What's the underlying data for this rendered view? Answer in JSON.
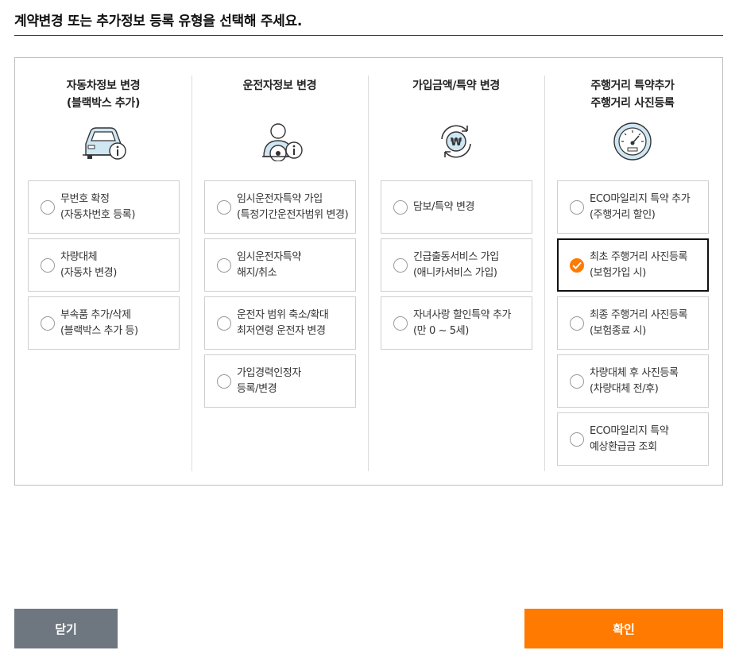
{
  "header": {
    "title": "계약변경 또는 추가정보 등록 유형을 선택해 주세요."
  },
  "columns": [
    {
      "title": [
        "자동차정보 변경",
        "(블랙박스 추가)"
      ],
      "icon": "car-info-icon",
      "options": [
        {
          "lines": [
            "무번호 확정",
            "(자동차번호 등록)"
          ],
          "selected": false
        },
        {
          "lines": [
            "차량대체",
            "(자동차 변경)"
          ],
          "selected": false
        },
        {
          "lines": [
            "부속품 추가/삭제",
            "(블랙박스 추가 등)"
          ],
          "selected": false
        }
      ]
    },
    {
      "title": [
        "운전자정보 변경"
      ],
      "icon": "driver-info-icon",
      "options": [
        {
          "lines": [
            "임시운전자특약 가입",
            "(특정기간운전자범위 변경)"
          ],
          "selected": false
        },
        {
          "lines": [
            "임시운전자특약",
            "해지/취소"
          ],
          "selected": false
        },
        {
          "lines": [
            "운전자 범위 축소/확대",
            "최저연령 운전자 변경"
          ],
          "selected": false
        },
        {
          "lines": [
            "가입경력인정자",
            "등록/변경"
          ],
          "selected": false
        }
      ]
    },
    {
      "title": [
        "가입금액/특약 변경"
      ],
      "icon": "won-exchange-icon",
      "options": [
        {
          "lines": [
            "담보/특약 변경"
          ],
          "selected": false
        },
        {
          "lines": [
            "긴급출동서비스 가입",
            "(애니카서비스 가입)"
          ],
          "selected": false
        },
        {
          "lines": [
            "자녀사랑 할인특약 추가",
            "(만 0 ~ 5세)"
          ],
          "selected": false
        }
      ]
    },
    {
      "title": [
        "주행거리 특약추가",
        "주행거리 사진등록"
      ],
      "icon": "speedometer-icon",
      "options": [
        {
          "lines": [
            "ECO마일리지 특약 추가",
            "(주행거리 할인)"
          ],
          "selected": false
        },
        {
          "lines": [
            "최초 주행거리 사진등록",
            "(보험가입 시)"
          ],
          "selected": true
        },
        {
          "lines": [
            "최종 주행거리 사진등록",
            "(보험종료 시)"
          ],
          "selected": false
        },
        {
          "lines": [
            "차량대체 후 사진등록",
            "(차량대체 전/후)"
          ],
          "selected": false
        },
        {
          "lines": [
            "ECO마일리지 특약",
            "예상환급금 조회"
          ],
          "selected": false
        }
      ]
    }
  ],
  "footer": {
    "close_label": "닫기",
    "confirm_label": "확인"
  },
  "colors": {
    "accent": "#ff7a00",
    "close_button": "#6e7680",
    "icon_blue": "#5a8fc4"
  }
}
